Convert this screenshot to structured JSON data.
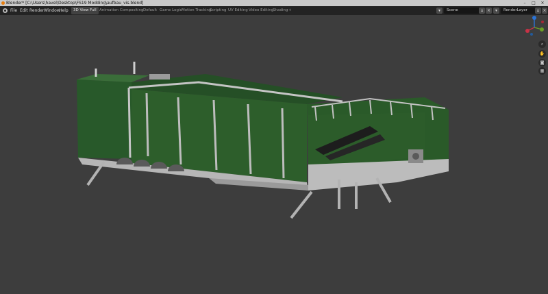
{
  "window": {
    "title": "Blender* [C:\\Users\\havel\\Desktop\\FS19 Modding\\aufbau_vis.blend]",
    "controls": [
      "–",
      "□",
      "✕"
    ]
  },
  "menubar": {
    "items": [
      "File",
      "Edit",
      "Render",
      "Window",
      "Help"
    ],
    "tabs": [
      "3D View Full",
      "Animation",
      "Compositing",
      "Default",
      "Game Logic",
      "Motion Tracking",
      "Scripting",
      "UV Editing",
      "Video Editing",
      "Shading"
    ],
    "active_tab": "3D View Full",
    "add_tab": "+",
    "scene": "Scene",
    "render_layer": "RenderLayer"
  },
  "gizmo": {
    "x": "X",
    "y": "Y",
    "z": "Z"
  },
  "nav_icons": [
    "zoom-icon",
    "hand-icon",
    "camera-icon",
    "grid-icon"
  ],
  "colors": {
    "body_green": "#2d5e2b",
    "frame_grey": "#b9b9b9",
    "viewport_bg": "#3d3d3d"
  }
}
